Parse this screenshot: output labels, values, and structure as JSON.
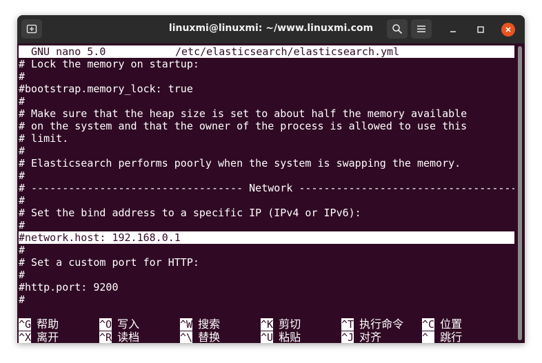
{
  "window": {
    "title": "linuxmi@linuxmi: ~/www.linuxmi.com"
  },
  "nano": {
    "version": "GNU nano 5.0",
    "filename": "/etc/elasticsearch/elasticsearch.yml"
  },
  "lines": [
    "# Lock the memory on startup:",
    "#",
    "#bootstrap.memory_lock: true",
    "#",
    "# Make sure that the heap size is set to about half the memory available",
    "# on the system and that the owner of the process is allowed to use this",
    "# limit.",
    "#",
    "# Elasticsearch performs poorly when the system is swapping the memory.",
    "#",
    "# ---------------------------------- Network -----------------------------------",
    "#",
    "# Set the bind address to a specific IP (IPv4 or IPv6):",
    "#",
    "#network.host: 192.168.0.1",
    "#",
    "# Set a custom port for HTTP:",
    "#",
    "#http.port: 9200",
    "#"
  ],
  "highlighted_line_index": 14,
  "shortcuts": [
    {
      "key": "^G",
      "label": "帮助"
    },
    {
      "key": "^O",
      "label": "写入"
    },
    {
      "key": "^W",
      "label": "搜索"
    },
    {
      "key": "^K",
      "label": "剪切"
    },
    {
      "key": "^T",
      "label": "执行命令"
    },
    {
      "key": "^C",
      "label": "位置"
    },
    {
      "key": "^X",
      "label": "离开"
    },
    {
      "key": "^R",
      "label": "读档"
    },
    {
      "key": "^\\",
      "label": "替换"
    },
    {
      "key": "^U",
      "label": "粘贴"
    },
    {
      "key": "^J",
      "label": "对齐"
    },
    {
      "key": "^_",
      "label": "跳行"
    }
  ],
  "colors": {
    "terminal_bg": "#300a24",
    "titlebar_bg": "#2b2b2b",
    "close_button": "#e95420"
  },
  "icons": {
    "new_tab": "new-tab-icon",
    "search": "search-icon",
    "menu": "hamburger-menu-icon",
    "minimize": "minimize-icon",
    "maximize": "maximize-icon",
    "close": "close-icon"
  }
}
